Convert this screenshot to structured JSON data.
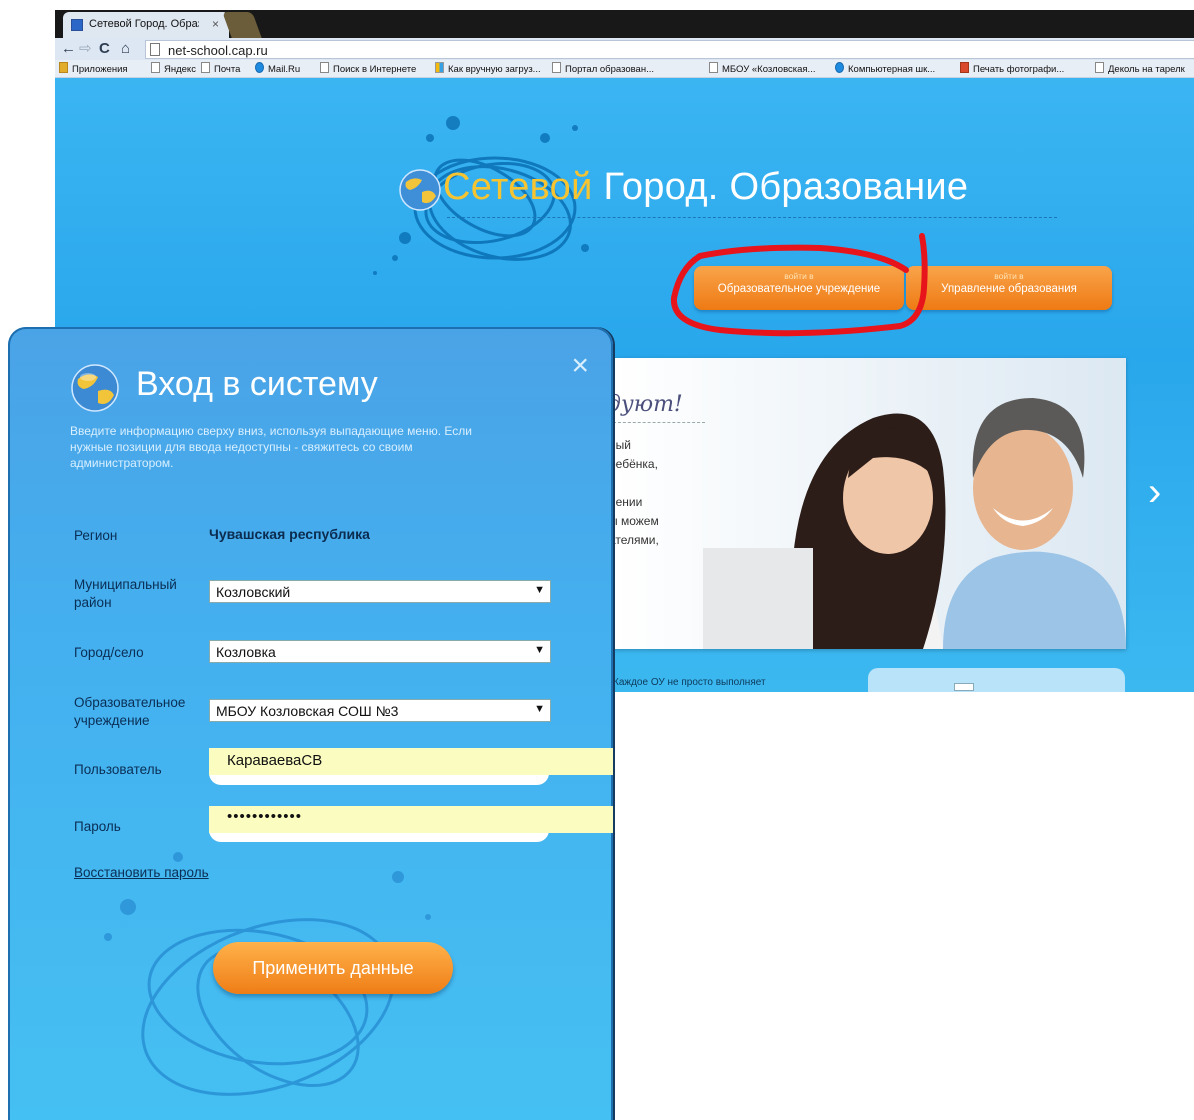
{
  "browser": {
    "tab_title": "Сетевой Город. Образов",
    "tab_close": "×",
    "url": "net-school.cap.ru",
    "nav": {
      "back": "←",
      "forward": "⇨",
      "reload": "C",
      "home": "⌂"
    },
    "bookmarks": [
      "Приложения",
      "Яндекс",
      "Почта",
      "Mail.Ru",
      "Поиск в Интернете",
      "Как вручную загруз...",
      "Портал образован...",
      "МБОУ «Козловская...",
      "Компьютерная шк...",
      "Печать фотографи...",
      "Деколь на тарелк"
    ]
  },
  "site": {
    "title_accent": "Сетевой",
    "title_rest": " Город. Образование",
    "buttons": [
      {
        "small": "войти в",
        "label": "Образовательное учреждение"
      },
      {
        "small": "войти в",
        "label": "Управление образования"
      }
    ],
    "promo": {
      "heading": "дуют!",
      "lines": [
        "ный",
        "ребёнка,",
        "и",
        "нении",
        "ы можем",
        "ателями,"
      ]
    },
    "next_arrow": "›",
    "bottom_text": "Каждое ОУ не просто выполняет"
  },
  "dialog": {
    "title": "Вход в систему",
    "close": "×",
    "hint": "Введите информацию сверху вниз, используя выпадающие меню. Если нужные позиции для ввода недоступны - свяжитесь со своим администратором.",
    "region": {
      "label": "Регион",
      "value": "Чувашская республика"
    },
    "district": {
      "label_1": "Муниципальный",
      "label_2": "район",
      "value": "Козловский"
    },
    "city": {
      "label": "Город/село",
      "value": "Козловка"
    },
    "school": {
      "label_1": "Образовательное",
      "label_2": "учреждение",
      "value": "МБОУ Козловская СОШ №3"
    },
    "user": {
      "label": "Пользователь",
      "value": "КараваеваСВ"
    },
    "password": {
      "label": "Пароль",
      "value": "••••••••••••"
    },
    "select_arrow": "▼",
    "restore": "Восстановить пароль",
    "apply": "Применить данные"
  },
  "colors": {
    "site_bg": "#2aa8ec",
    "dialog_bg": "#44b0ef",
    "orange_button": "#ef7d16",
    "highlight_circle": "#e8141c",
    "autofill": "#fbfdc0"
  }
}
